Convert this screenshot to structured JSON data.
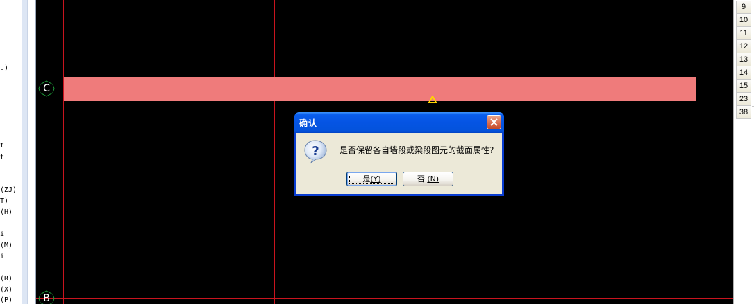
{
  "left_panel": {
    "fragments": [
      {
        "text": ".)"
      },
      {
        "text": "t"
      },
      {
        "text": "t"
      },
      {
        "text": "(ZJ)"
      },
      {
        "text": "T)"
      },
      {
        "text": "(H)"
      },
      {
        "text": "i"
      },
      {
        "text": "(M)"
      },
      {
        "text": "i"
      },
      {
        "text": "(R)"
      },
      {
        "text": "(X)"
      },
      {
        "text": "(P)"
      }
    ]
  },
  "canvas": {
    "background": "#000000",
    "grid_color": "#c8141e",
    "beam_color": "#ef7b7b",
    "axes": [
      {
        "label": "C"
      },
      {
        "label": "B"
      }
    ]
  },
  "right_panel": {
    "rows": [
      "9",
      "10",
      "11",
      "12",
      "13",
      "14",
      "15",
      "23",
      "38"
    ]
  },
  "dialog": {
    "title": "确认",
    "message": "是否保留各自墙段或梁段图元的截面属性?",
    "icon": "question-icon",
    "yes_button": {
      "text": "是",
      "accel": "(Y)"
    },
    "no_button": {
      "text": "否",
      "accel": "(N)"
    },
    "close_icon": "close-icon"
  }
}
